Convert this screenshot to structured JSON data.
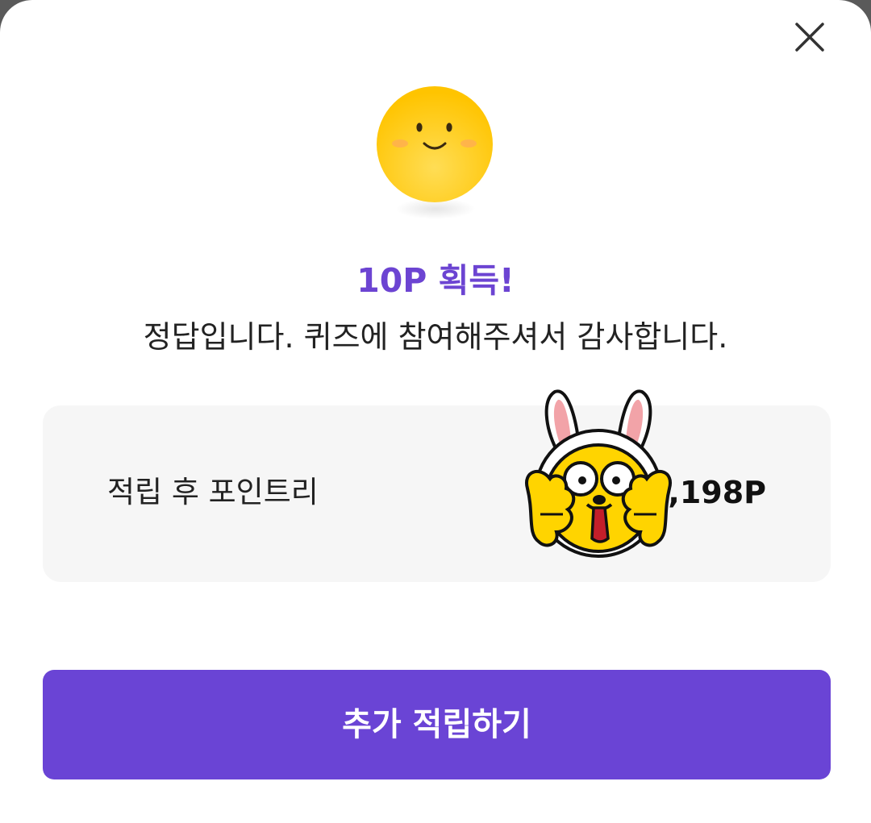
{
  "dialog": {
    "close_icon": "close-icon",
    "emoji_icon": "smiley-face-icon",
    "headline": "10P 획득!",
    "message": "정답입니다. 퀴즈에 참여해주셔서 감사합니다.",
    "point_card": {
      "label": "적립 후 포인트리",
      "value": ",198P",
      "sticker_icon": "rabbit-character-sticker"
    },
    "primary_button_label": "추가 적립하기"
  },
  "colors": {
    "accent": "#6a44d5",
    "headline": "#6c44d2",
    "card_background": "#f6f6f6",
    "emoji_yellow": "#ffc90a"
  }
}
